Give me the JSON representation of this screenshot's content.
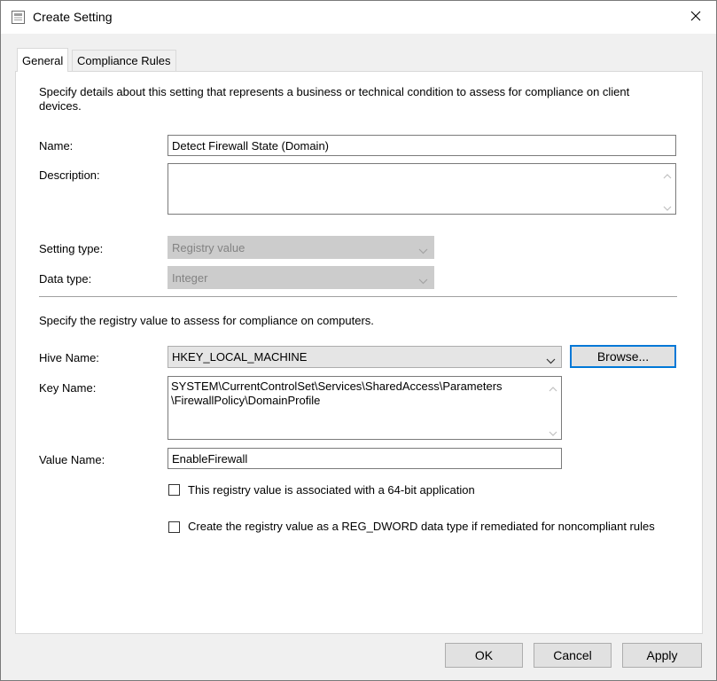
{
  "window": {
    "title": "Create Setting"
  },
  "tabs": [
    {
      "label": "General",
      "active": true
    },
    {
      "label": "Compliance Rules",
      "active": false
    }
  ],
  "general": {
    "intro": "Specify details about this setting that represents a business or technical condition to assess for compliance on client devices.",
    "name_label": "Name:",
    "name_value": "Detect Firewall State (Domain)",
    "description_label": "Description:",
    "description_value": "",
    "setting_type_label": "Setting type:",
    "setting_type_value": "Registry value",
    "data_type_label": "Data type:",
    "data_type_value": "Integer"
  },
  "registry": {
    "intro": "Specify the registry value to assess for compliance on computers.",
    "hive_label": "Hive Name:",
    "hive_value": "HKEY_LOCAL_MACHINE",
    "browse_label": "Browse...",
    "key_label": "Key Name:",
    "key_value": "SYSTEM\\CurrentControlSet\\Services\\SharedAccess\\Parameters\n\\FirewallPolicy\\DomainProfile",
    "value_name_label": "Value Name:",
    "value_name_value": "EnableFirewall",
    "checkbox_64bit_label": "This registry value is associated with a 64-bit application",
    "checkbox_64bit_checked": false,
    "checkbox_dword_label": "Create the registry value as a REG_DWORD data type if remediated for noncompliant rules",
    "checkbox_dword_checked": false
  },
  "footer": {
    "ok_label": "OK",
    "cancel_label": "Cancel",
    "apply_label": "Apply"
  },
  "colors": {
    "focus_border": "#0078d7",
    "window_bg": "#f0f0f0",
    "disabled_combo_bg": "#cccccc"
  },
  "icons": {
    "title": "settings-dialog-icon",
    "close": "close-icon",
    "dropdown": "chevron-down-icon",
    "scroll_up": "scroll-up-arrow-icon",
    "scroll_down": "scroll-down-arrow-icon"
  }
}
